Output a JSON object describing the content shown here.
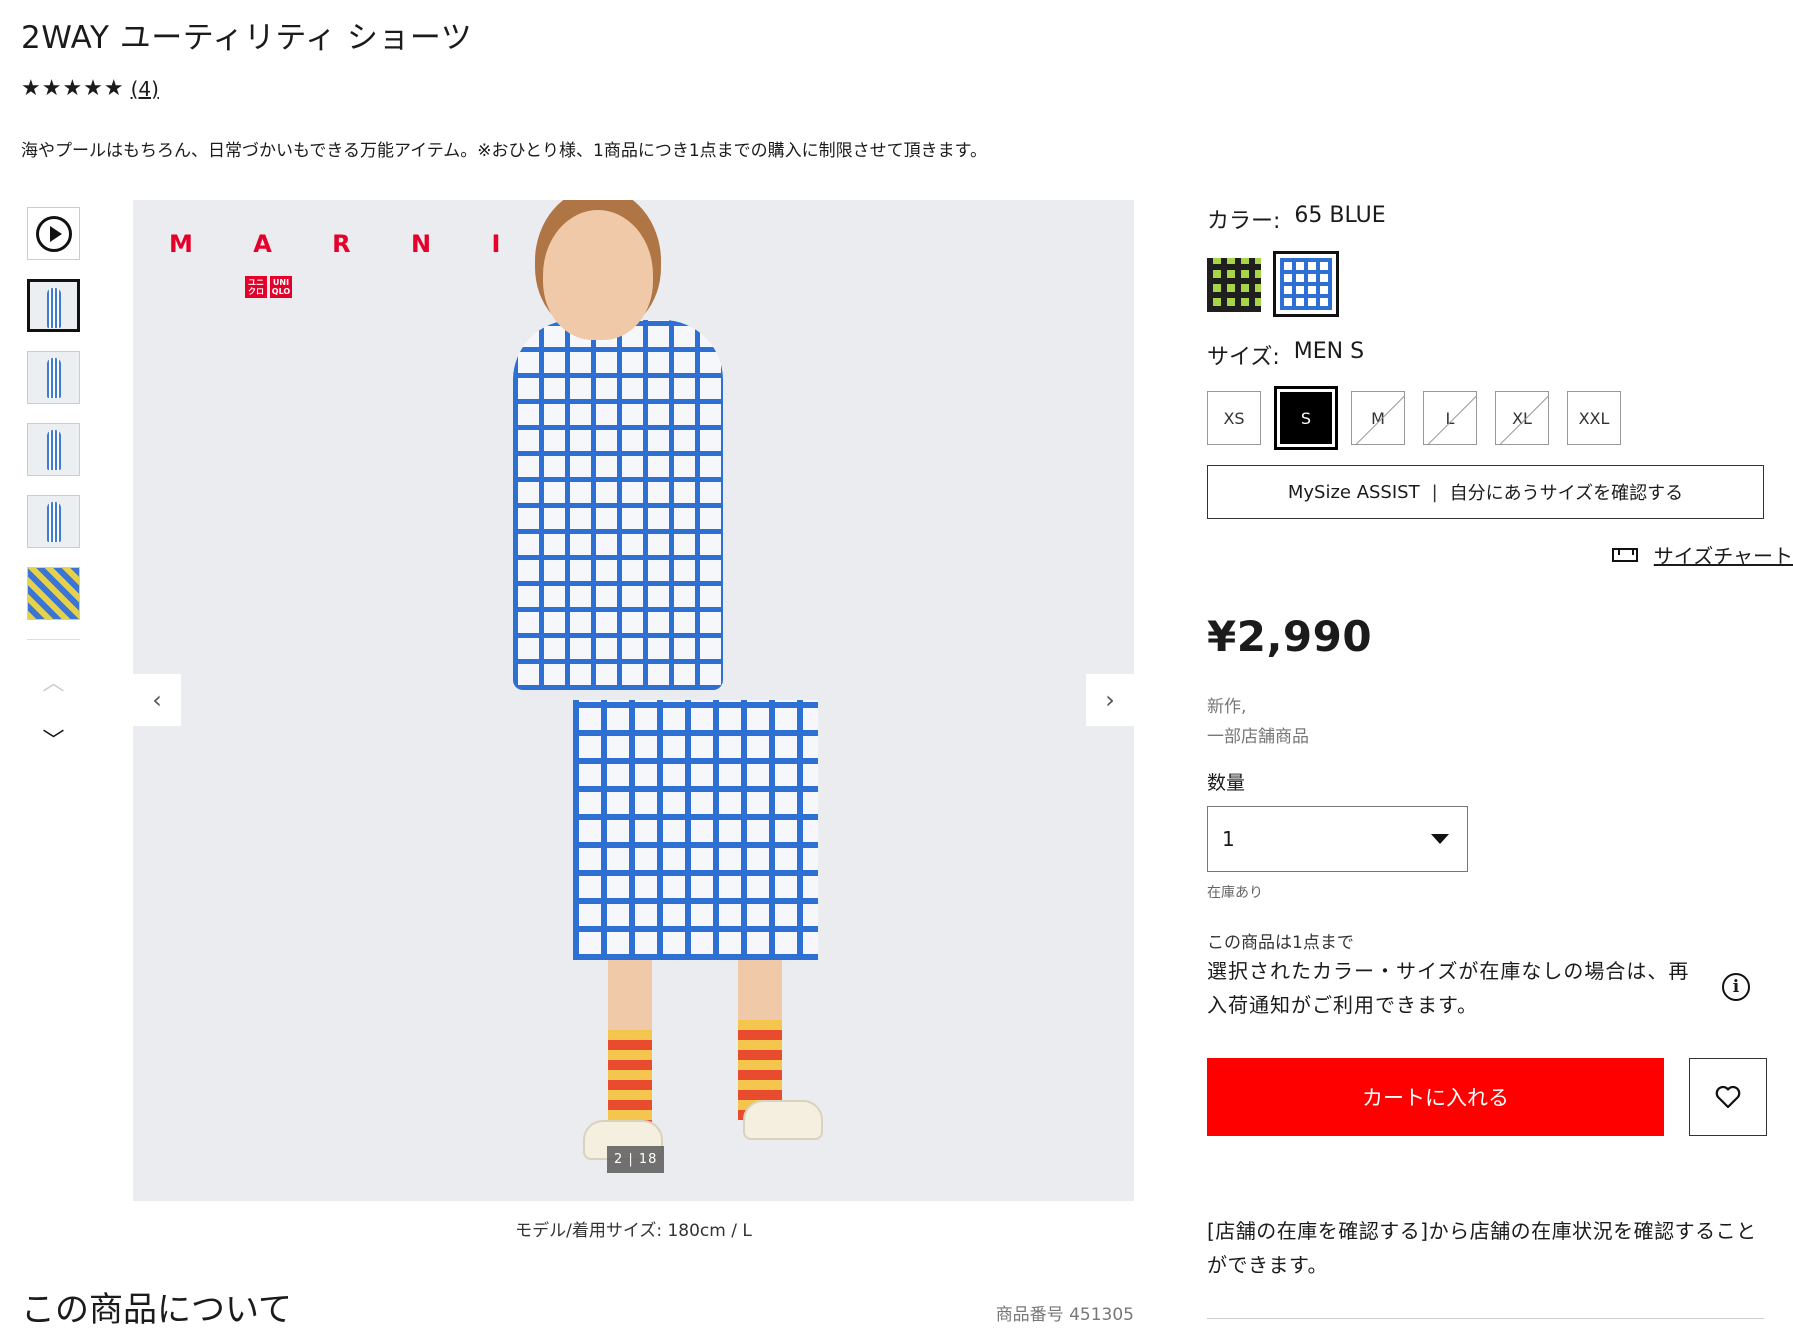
{
  "product": {
    "title": "2WAY ユーティリティ ショーツ",
    "stars": "★★★★★",
    "review_count": "(4)",
    "rating": 5,
    "description": "海やプールはもちろん、日常づかいもできる万能アイテム。※おひとり様、1商品につき1点までの購入に制限させて頂きます。"
  },
  "gallery": {
    "brand_text": "M A R N I",
    "uq_logo": [
      "ユニ\nクロ",
      "UNI\nQLO"
    ],
    "counter": "2 | 18",
    "caption": "モデル/着用サイズ: 180cm / L",
    "thumbnails": [
      "video",
      "image-1",
      "image-2",
      "image-3",
      "image-4",
      "image-5"
    ],
    "active_thumbnail": 1
  },
  "about": {
    "title": "この商品について",
    "product_number": "商品番号 451305"
  },
  "options": {
    "color_label": "カラー:",
    "color_value": "65 BLUE",
    "colors": [
      {
        "name": "green-check",
        "hex": "#a8d44a",
        "selected": false
      },
      {
        "name": "blue-check",
        "hex": "#2e6fd3",
        "selected": true
      }
    ],
    "size_label": "サイズ:",
    "size_value": "MEN S",
    "sizes": [
      {
        "label": "XS",
        "state": "available"
      },
      {
        "label": "S",
        "state": "selected"
      },
      {
        "label": "M",
        "state": "unavailable"
      },
      {
        "label": "L",
        "state": "unavailable"
      },
      {
        "label": "XL",
        "state": "unavailable"
      },
      {
        "label": "XXL",
        "state": "available"
      }
    ],
    "mysize_brand": "MySize ASSIST",
    "mysize_separator": "|",
    "mysize_text": "自分にあうサイズを確認する",
    "size_chart_label": "サイズチャート"
  },
  "purchase": {
    "price": "¥2,990",
    "badge_1": "新作,",
    "badge_2": "一部店舗商品",
    "qty_label": "数量",
    "qty_value": "1",
    "stock_status": "在庫あり",
    "limit_note": "この商品は1点まで",
    "restock_note": "選択されたカラー・サイズが在庫なしの場合は、再入荷通知がご利用できます。",
    "info_glyph": "i",
    "cart_label": "カートに入れる",
    "store_note": "[店舗の在庫を確認する]から店舗の在庫状況を確認することができます。",
    "accent_color": "#ff0000"
  }
}
